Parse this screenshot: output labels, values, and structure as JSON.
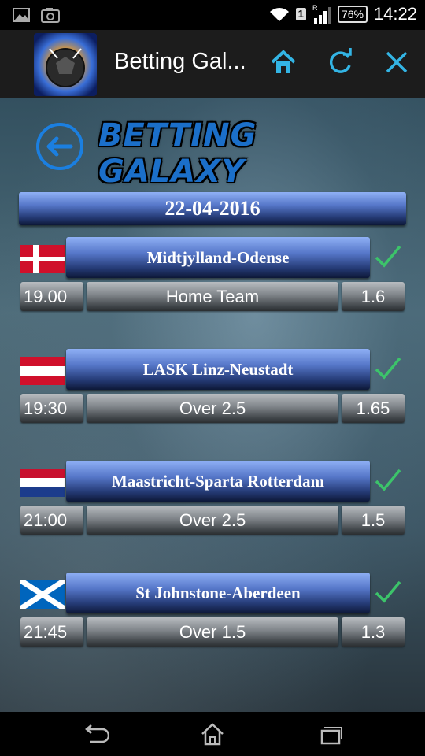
{
  "status_bar": {
    "icons_left": [
      "image-icon",
      "camera-icon"
    ],
    "icons_right": [
      "wifi-icon",
      "sim-icon",
      "signal-icon",
      "battery-icon"
    ],
    "sim": "1",
    "roaming": "R",
    "battery": "76%",
    "time": "14:22"
  },
  "action_bar": {
    "title": "Betting Gal...",
    "buttons": [
      "home-icon",
      "refresh-icon",
      "close-icon"
    ],
    "accent": "#33b5e5"
  },
  "header": {
    "logo_text": "BETTING GALAXY",
    "back_icon": "back-arrow-icon"
  },
  "date": "22-04-2016",
  "matches": [
    {
      "flag": "denmark",
      "teams": "Midtjylland-Odense",
      "time": "19.00",
      "tip": "Home Team",
      "odds": "1.6",
      "status": "check-icon"
    },
    {
      "flag": "austria",
      "teams": "LASK Linz-Neustadt",
      "time": "19:30",
      "tip": "Over 2.5",
      "odds": "1.65",
      "status": "check-icon"
    },
    {
      "flag": "netherlands",
      "teams": "Maastricht-Sparta Rotterdam",
      "time": "21:00",
      "tip": "Over 2.5",
      "odds": "1.5",
      "status": "check-icon"
    },
    {
      "flag": "scotland",
      "teams": "St Johnstone-Aberdeen",
      "time": "21:45",
      "tip": "Over 1.5",
      "odds": "1.3",
      "status": "check-icon"
    }
  ],
  "colors": {
    "check": "#3cc46a",
    "logo": "#1b6fc9"
  },
  "nav_bar": [
    "back-icon",
    "home-icon",
    "recents-icon"
  ]
}
